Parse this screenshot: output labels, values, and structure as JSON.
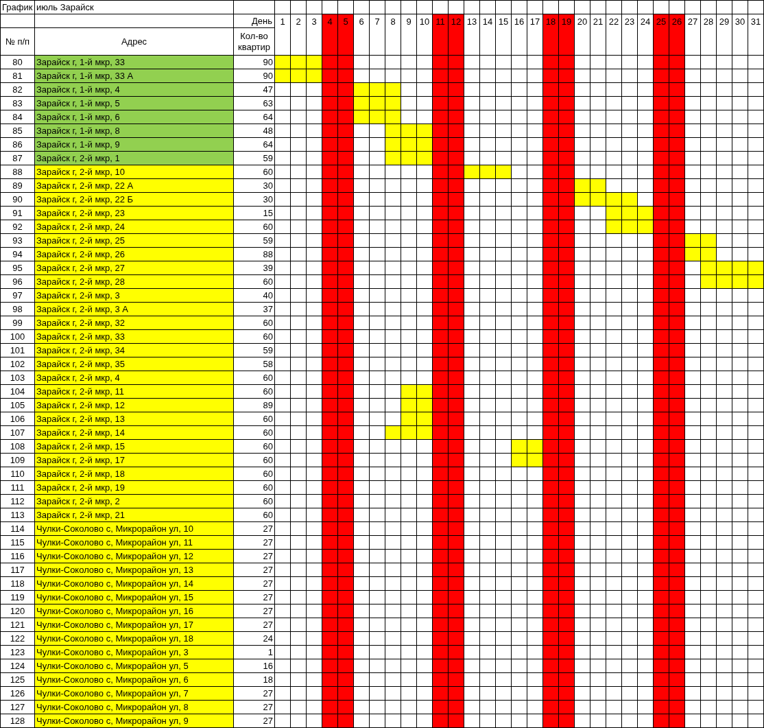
{
  "sheet": {
    "label": "График",
    "title": "июль Зарайск"
  },
  "headers": {
    "day": "День",
    "number": "№ п/п",
    "address": "Адрес",
    "quantity": "Кол-во квартир"
  },
  "days": [
    {
      "label": "1",
      "weekend": false
    },
    {
      "label": "2",
      "weekend": false
    },
    {
      "label": "3",
      "weekend": false
    },
    {
      "label": "4",
      "weekend": true
    },
    {
      "label": "5",
      "weekend": true
    },
    {
      "label": "6",
      "weekend": false
    },
    {
      "label": "7",
      "weekend": false
    },
    {
      "label": "8",
      "weekend": false
    },
    {
      "label": "9",
      "weekend": false
    },
    {
      "label": "10",
      "weekend": false
    },
    {
      "label": "11",
      "weekend": true
    },
    {
      "label": "12",
      "weekend": true
    },
    {
      "label": "13",
      "weekend": false
    },
    {
      "label": "14",
      "weekend": false
    },
    {
      "label": "15",
      "weekend": false
    },
    {
      "label": "16",
      "weekend": false
    },
    {
      "label": "17",
      "weekend": false
    },
    {
      "label": "18",
      "weekend": true
    },
    {
      "label": "19",
      "weekend": true
    },
    {
      "label": "20",
      "weekend": false
    },
    {
      "label": "21",
      "weekend": false
    },
    {
      "label": "22",
      "weekend": false
    },
    {
      "label": "23",
      "weekend": false
    },
    {
      "label": "24",
      "weekend": false
    },
    {
      "label": "25",
      "weekend": true
    },
    {
      "label": "26",
      "weekend": true
    },
    {
      "label": "27",
      "weekend": false
    },
    {
      "label": "28",
      "weekend": false
    },
    {
      "label": "29",
      "weekend": false
    },
    {
      "label": "30",
      "weekend": false
    },
    {
      "label": "31",
      "weekend": false
    }
  ],
  "rows": [
    {
      "number": "80",
      "address": "Зарайск г, 1-й мкр, 33",
      "color": "#92d050",
      "quantity": "90",
      "filled": [
        true,
        true,
        true,
        false,
        false,
        false,
        false,
        false,
        false,
        false,
        false,
        false,
        false,
        false,
        false,
        false,
        false,
        false,
        false,
        false,
        false,
        false,
        false,
        false,
        false,
        false,
        false,
        false,
        false,
        false,
        false
      ]
    },
    {
      "number": "81",
      "address": "Зарайск г, 1-й мкр, 33 А",
      "color": "#92d050",
      "quantity": "90",
      "filled": [
        true,
        true,
        true,
        false,
        false,
        false,
        false,
        false,
        false,
        false,
        false,
        false,
        false,
        false,
        false,
        false,
        false,
        false,
        false,
        false,
        false,
        false,
        false,
        false,
        false,
        false,
        false,
        false,
        false,
        false,
        false
      ]
    },
    {
      "number": "82",
      "address": "Зарайск г, 1-й мкр, 4",
      "color": "#92d050",
      "quantity": "47",
      "filled": [
        false,
        false,
        false,
        false,
        false,
        true,
        true,
        true,
        false,
        false,
        false,
        false,
        false,
        false,
        false,
        false,
        false,
        false,
        false,
        false,
        false,
        false,
        false,
        false,
        false,
        false,
        false,
        false,
        false,
        false,
        false
      ]
    },
    {
      "number": "83",
      "address": "Зарайск г, 1-й мкр, 5",
      "color": "#92d050",
      "quantity": "63",
      "filled": [
        false,
        false,
        false,
        false,
        false,
        true,
        true,
        true,
        false,
        false,
        false,
        false,
        false,
        false,
        false,
        false,
        false,
        false,
        false,
        false,
        false,
        false,
        false,
        false,
        false,
        false,
        false,
        false,
        false,
        false,
        false
      ]
    },
    {
      "number": "84",
      "address": "Зарайск г, 1-й мкр, 6",
      "color": "#92d050",
      "quantity": "64",
      "filled": [
        false,
        false,
        false,
        false,
        false,
        true,
        true,
        true,
        false,
        false,
        false,
        false,
        false,
        false,
        false,
        false,
        false,
        false,
        false,
        false,
        false,
        false,
        false,
        false,
        false,
        false,
        false,
        false,
        false,
        false,
        false
      ]
    },
    {
      "number": "85",
      "address": "Зарайск г, 1-й мкр, 8",
      "color": "#92d050",
      "quantity": "48",
      "filled": [
        false,
        false,
        false,
        false,
        false,
        false,
        false,
        true,
        true,
        true,
        false,
        false,
        false,
        false,
        false,
        false,
        false,
        false,
        false,
        false,
        false,
        false,
        false,
        false,
        false,
        false,
        false,
        false,
        false,
        false,
        false
      ]
    },
    {
      "number": "86",
      "address": "Зарайск г, 1-й мкр, 9",
      "color": "#92d050",
      "quantity": "64",
      "filled": [
        false,
        false,
        false,
        false,
        false,
        false,
        false,
        true,
        true,
        true,
        false,
        false,
        false,
        false,
        false,
        false,
        false,
        false,
        false,
        false,
        false,
        false,
        false,
        false,
        false,
        false,
        false,
        false,
        false,
        false,
        false
      ]
    },
    {
      "number": "87",
      "address": "Зарайск г, 2-й мкр, 1",
      "color": "#92d050",
      "quantity": "59",
      "filled": [
        false,
        false,
        false,
        false,
        false,
        false,
        false,
        true,
        true,
        true,
        false,
        false,
        false,
        false,
        false,
        false,
        false,
        false,
        false,
        false,
        false,
        false,
        false,
        false,
        false,
        false,
        false,
        false,
        false,
        false,
        false
      ]
    },
    {
      "number": "88",
      "address": "Зарайск г, 2-й мкр, 10",
      "color": "#ffff00",
      "quantity": "60",
      "filled": [
        false,
        false,
        false,
        false,
        false,
        false,
        false,
        false,
        false,
        false,
        false,
        false,
        true,
        true,
        true,
        false,
        false,
        false,
        false,
        false,
        false,
        false,
        false,
        false,
        false,
        false,
        false,
        false,
        false,
        false,
        false
      ]
    },
    {
      "number": "89",
      "address": "Зарайск г, 2-й мкр, 22 А",
      "color": "#ffff00",
      "quantity": "30",
      "filled": [
        false,
        false,
        false,
        false,
        false,
        false,
        false,
        false,
        false,
        false,
        false,
        false,
        false,
        false,
        false,
        false,
        false,
        false,
        false,
        true,
        true,
        false,
        false,
        false,
        false,
        false,
        false,
        false,
        false,
        false,
        false
      ]
    },
    {
      "number": "90",
      "address": "Зарайск г, 2-й мкр, 22 Б",
      "color": "#ffff00",
      "quantity": "30",
      "filled": [
        false,
        false,
        false,
        false,
        false,
        false,
        false,
        false,
        false,
        false,
        false,
        false,
        false,
        false,
        false,
        false,
        false,
        false,
        false,
        true,
        true,
        true,
        true,
        false,
        false,
        false,
        false,
        false,
        false,
        false,
        false
      ]
    },
    {
      "number": "91",
      "address": "Зарайск г, 2-й мкр, 23",
      "color": "#ffff00",
      "quantity": "15",
      "filled": [
        false,
        false,
        false,
        false,
        false,
        false,
        false,
        false,
        false,
        false,
        false,
        false,
        false,
        false,
        false,
        false,
        false,
        false,
        false,
        false,
        false,
        true,
        true,
        true,
        false,
        false,
        false,
        false,
        false,
        false,
        false
      ]
    },
    {
      "number": "92",
      "address": "Зарайск г, 2-й мкр, 24",
      "color": "#ffff00",
      "quantity": "60",
      "filled": [
        false,
        false,
        false,
        false,
        false,
        false,
        false,
        false,
        false,
        false,
        false,
        false,
        false,
        false,
        false,
        false,
        false,
        false,
        false,
        false,
        false,
        true,
        true,
        true,
        false,
        false,
        false,
        false,
        false,
        false,
        false
      ]
    },
    {
      "number": "93",
      "address": "Зарайск г, 2-й мкр, 25",
      "color": "#ffff00",
      "quantity": "59",
      "filled": [
        false,
        false,
        false,
        false,
        false,
        false,
        false,
        false,
        false,
        false,
        false,
        false,
        false,
        false,
        false,
        false,
        false,
        false,
        false,
        false,
        false,
        false,
        false,
        false,
        false,
        false,
        true,
        true,
        false,
        false,
        false
      ]
    },
    {
      "number": "94",
      "address": "Зарайск г, 2-й мкр, 26",
      "color": "#ffff00",
      "quantity": "88",
      "filled": [
        false,
        false,
        false,
        false,
        false,
        false,
        false,
        false,
        false,
        false,
        false,
        false,
        false,
        false,
        false,
        false,
        false,
        false,
        false,
        false,
        false,
        false,
        false,
        false,
        false,
        false,
        true,
        true,
        false,
        false,
        false
      ]
    },
    {
      "number": "95",
      "address": "Зарайск г, 2-й мкр, 27",
      "color": "#ffff00",
      "quantity": "39",
      "filled": [
        false,
        false,
        false,
        false,
        false,
        false,
        false,
        false,
        false,
        false,
        false,
        false,
        false,
        false,
        false,
        false,
        false,
        false,
        false,
        false,
        false,
        false,
        false,
        false,
        false,
        false,
        false,
        true,
        true,
        true,
        true
      ]
    },
    {
      "number": "96",
      "address": "Зарайск г, 2-й мкр, 28",
      "color": "#ffff00",
      "quantity": "60",
      "filled": [
        false,
        false,
        false,
        false,
        false,
        false,
        false,
        false,
        false,
        false,
        false,
        false,
        false,
        false,
        false,
        false,
        false,
        false,
        false,
        false,
        false,
        false,
        false,
        false,
        false,
        false,
        false,
        true,
        true,
        true,
        true
      ]
    },
    {
      "number": "97",
      "address": "Зарайск г, 2-й мкр, 3",
      "color": "#ffff00",
      "quantity": "40",
      "filled": [
        false,
        false,
        false,
        false,
        false,
        false,
        false,
        false,
        false,
        false,
        false,
        false,
        false,
        false,
        false,
        false,
        false,
        false,
        false,
        false,
        false,
        false,
        false,
        false,
        false,
        false,
        false,
        false,
        false,
        false,
        false
      ]
    },
    {
      "number": "98",
      "address": "Зарайск г, 2-й мкр, 3 А",
      "color": "#ffff00",
      "quantity": "37",
      "filled": [
        false,
        false,
        false,
        false,
        false,
        false,
        false,
        false,
        false,
        false,
        false,
        false,
        false,
        false,
        false,
        false,
        false,
        false,
        false,
        false,
        false,
        false,
        false,
        false,
        false,
        false,
        false,
        false,
        false,
        false,
        false
      ]
    },
    {
      "number": "99",
      "address": "Зарайск г, 2-й мкр, 32",
      "color": "#ffff00",
      "quantity": "60",
      "filled": [
        false,
        false,
        false,
        false,
        false,
        false,
        false,
        false,
        false,
        false,
        false,
        false,
        false,
        false,
        false,
        false,
        false,
        false,
        false,
        false,
        false,
        false,
        false,
        false,
        false,
        false,
        false,
        false,
        false,
        false,
        false
      ]
    },
    {
      "number": "100",
      "address": "Зарайск г, 2-й мкр, 33",
      "color": "#ffff00",
      "quantity": "60",
      "filled": [
        false,
        false,
        false,
        false,
        false,
        false,
        false,
        false,
        false,
        false,
        false,
        false,
        false,
        false,
        false,
        false,
        false,
        false,
        false,
        false,
        false,
        false,
        false,
        false,
        false,
        false,
        false,
        false,
        false,
        false,
        false
      ]
    },
    {
      "number": "101",
      "address": "Зарайск г, 2-й мкр, 34",
      "color": "#ffff00",
      "quantity": "59",
      "filled": [
        false,
        false,
        false,
        false,
        false,
        false,
        false,
        false,
        false,
        false,
        false,
        false,
        false,
        false,
        false,
        false,
        false,
        false,
        false,
        false,
        false,
        false,
        false,
        false,
        false,
        false,
        false,
        false,
        false,
        false,
        false
      ]
    },
    {
      "number": "102",
      "address": "Зарайск г, 2-й мкр, 35",
      "color": "#ffff00",
      "quantity": "58",
      "filled": [
        false,
        false,
        false,
        false,
        false,
        false,
        false,
        false,
        false,
        false,
        false,
        false,
        false,
        false,
        false,
        false,
        false,
        false,
        false,
        false,
        false,
        false,
        false,
        false,
        false,
        false,
        false,
        false,
        false,
        false,
        false
      ]
    },
    {
      "number": "103",
      "address": "Зарайск г, 2-й мкр, 4",
      "color": "#ffff00",
      "quantity": "60",
      "filled": [
        false,
        false,
        false,
        false,
        false,
        false,
        false,
        false,
        false,
        false,
        false,
        false,
        false,
        false,
        false,
        false,
        false,
        false,
        false,
        false,
        false,
        false,
        false,
        false,
        false,
        false,
        false,
        false,
        false,
        false,
        false
      ]
    },
    {
      "number": "104",
      "address": "Зарайск г, 2-й мкр, 11",
      "color": "#ffff00",
      "quantity": "60",
      "filled": [
        false,
        false,
        false,
        false,
        false,
        false,
        false,
        false,
        true,
        true,
        false,
        false,
        false,
        false,
        false,
        false,
        false,
        false,
        false,
        false,
        false,
        false,
        false,
        false,
        false,
        false,
        false,
        false,
        false,
        false,
        false
      ]
    },
    {
      "number": "105",
      "address": "Зарайск г, 2-й мкр, 12",
      "color": "#ffff00",
      "quantity": "89",
      "filled": [
        false,
        false,
        false,
        false,
        false,
        false,
        false,
        false,
        true,
        true,
        false,
        false,
        false,
        false,
        false,
        false,
        false,
        false,
        false,
        false,
        false,
        false,
        false,
        false,
        false,
        false,
        false,
        false,
        false,
        false,
        false
      ]
    },
    {
      "number": "106",
      "address": "Зарайск г, 2-й мкр, 13",
      "color": "#ffff00",
      "quantity": "60",
      "filled": [
        false,
        false,
        false,
        false,
        false,
        false,
        false,
        false,
        true,
        true,
        false,
        false,
        false,
        false,
        false,
        false,
        false,
        false,
        false,
        false,
        false,
        false,
        false,
        false,
        false,
        false,
        false,
        false,
        false,
        false,
        false
      ]
    },
    {
      "number": "107",
      "address": "Зарайск г, 2-й мкр, 14",
      "color": "#ffff00",
      "quantity": "60",
      "filled": [
        false,
        false,
        false,
        false,
        false,
        false,
        false,
        true,
        true,
        true,
        false,
        false,
        false,
        false,
        false,
        false,
        false,
        false,
        false,
        false,
        false,
        false,
        false,
        false,
        false,
        false,
        false,
        false,
        false,
        false,
        false
      ]
    },
    {
      "number": "108",
      "address": "Зарайск г, 2-й мкр, 15",
      "color": "#ffff00",
      "quantity": "60",
      "filled": [
        false,
        false,
        false,
        false,
        false,
        false,
        false,
        false,
        false,
        false,
        false,
        false,
        false,
        false,
        false,
        true,
        true,
        false,
        false,
        false,
        false,
        false,
        false,
        false,
        false,
        false,
        false,
        false,
        false,
        false,
        false
      ]
    },
    {
      "number": "109",
      "address": "Зарайск г, 2-й мкр, 17",
      "color": "#ffff00",
      "quantity": "60",
      "filled": [
        false,
        false,
        false,
        false,
        false,
        false,
        false,
        false,
        false,
        false,
        false,
        false,
        false,
        false,
        false,
        true,
        true,
        false,
        false,
        false,
        false,
        false,
        false,
        false,
        false,
        false,
        false,
        false,
        false,
        false,
        false
      ]
    },
    {
      "number": "110",
      "address": "Зарайск г, 2-й мкр, 18",
      "color": "#ffff00",
      "quantity": "60",
      "filled": [
        false,
        false,
        false,
        false,
        false,
        false,
        false,
        false,
        false,
        false,
        false,
        false,
        false,
        false,
        false,
        false,
        false,
        false,
        false,
        false,
        false,
        false,
        false,
        false,
        false,
        false,
        false,
        false,
        false,
        false,
        false
      ]
    },
    {
      "number": "111",
      "address": "Зарайск г, 2-й мкр, 19",
      "color": "#ffff00",
      "quantity": "60",
      "filled": [
        false,
        false,
        false,
        false,
        false,
        false,
        false,
        false,
        false,
        false,
        false,
        false,
        false,
        false,
        false,
        false,
        false,
        false,
        false,
        false,
        false,
        false,
        false,
        false,
        false,
        false,
        false,
        false,
        false,
        false,
        false
      ]
    },
    {
      "number": "112",
      "address": "Зарайск г, 2-й мкр, 2",
      "color": "#ffff00",
      "quantity": "60",
      "filled": [
        false,
        false,
        false,
        false,
        false,
        false,
        false,
        false,
        false,
        false,
        false,
        false,
        false,
        false,
        false,
        false,
        false,
        false,
        false,
        false,
        false,
        false,
        false,
        false,
        false,
        false,
        false,
        false,
        false,
        false,
        false
      ]
    },
    {
      "number": "113",
      "address": "Зарайск г, 2-й мкр, 21",
      "color": "#ffff00",
      "quantity": "60",
      "filled": [
        false,
        false,
        false,
        false,
        false,
        false,
        false,
        false,
        false,
        false,
        false,
        false,
        false,
        false,
        false,
        false,
        false,
        false,
        false,
        false,
        false,
        false,
        false,
        false,
        false,
        false,
        false,
        false,
        false,
        false,
        false
      ]
    },
    {
      "number": "114",
      "address": "Чулки-Соколово с, Микрорайон ул, 10",
      "color": "#ffff00",
      "quantity": "27",
      "filled": [
        false,
        false,
        false,
        false,
        false,
        false,
        false,
        false,
        false,
        false,
        false,
        false,
        false,
        false,
        false,
        false,
        false,
        false,
        false,
        false,
        false,
        false,
        false,
        false,
        false,
        false,
        false,
        false,
        false,
        false,
        false
      ]
    },
    {
      "number": "115",
      "address": "Чулки-Соколово с, Микрорайон ул, 11",
      "color": "#ffff00",
      "quantity": "27",
      "filled": [
        false,
        false,
        false,
        false,
        false,
        false,
        false,
        false,
        false,
        false,
        false,
        false,
        false,
        false,
        false,
        false,
        false,
        false,
        false,
        false,
        false,
        false,
        false,
        false,
        false,
        false,
        false,
        false,
        false,
        false,
        false
      ]
    },
    {
      "number": "116",
      "address": "Чулки-Соколово с, Микрорайон ул, 12",
      "color": "#ffff00",
      "quantity": "27",
      "filled": [
        false,
        false,
        false,
        false,
        false,
        false,
        false,
        false,
        false,
        false,
        false,
        false,
        false,
        false,
        false,
        false,
        false,
        false,
        false,
        false,
        false,
        false,
        false,
        false,
        false,
        false,
        false,
        false,
        false,
        false,
        false
      ]
    },
    {
      "number": "117",
      "address": "Чулки-Соколово с, Микрорайон ул, 13",
      "color": "#ffff00",
      "quantity": "27",
      "filled": [
        false,
        false,
        false,
        false,
        false,
        false,
        false,
        false,
        false,
        false,
        false,
        false,
        false,
        false,
        false,
        false,
        false,
        false,
        false,
        false,
        false,
        false,
        false,
        false,
        false,
        false,
        false,
        false,
        false,
        false,
        false
      ]
    },
    {
      "number": "118",
      "address": "Чулки-Соколово с, Микрорайон ул, 14",
      "color": "#ffff00",
      "quantity": "27",
      "filled": [
        false,
        false,
        false,
        false,
        false,
        false,
        false,
        false,
        false,
        false,
        false,
        false,
        false,
        false,
        false,
        false,
        false,
        false,
        false,
        false,
        false,
        false,
        false,
        false,
        false,
        false,
        false,
        false,
        false,
        false,
        false
      ]
    },
    {
      "number": "119",
      "address": "Чулки-Соколово с, Микрорайон ул, 15",
      "color": "#ffff00",
      "quantity": "27",
      "filled": [
        false,
        false,
        false,
        false,
        false,
        false,
        false,
        false,
        false,
        false,
        false,
        false,
        false,
        false,
        false,
        false,
        false,
        false,
        false,
        false,
        false,
        false,
        false,
        false,
        false,
        false,
        false,
        false,
        false,
        false,
        false
      ]
    },
    {
      "number": "120",
      "address": "Чулки-Соколово с, Микрорайон ул, 16",
      "color": "#ffff00",
      "quantity": "27",
      "filled": [
        false,
        false,
        false,
        false,
        false,
        false,
        false,
        false,
        false,
        false,
        false,
        false,
        false,
        false,
        false,
        false,
        false,
        false,
        false,
        false,
        false,
        false,
        false,
        false,
        false,
        false,
        false,
        false,
        false,
        false,
        false
      ]
    },
    {
      "number": "121",
      "address": "Чулки-Соколово с, Микрорайон ул, 17",
      "color": "#ffff00",
      "quantity": "27",
      "filled": [
        false,
        false,
        false,
        false,
        false,
        false,
        false,
        false,
        false,
        false,
        false,
        false,
        false,
        false,
        false,
        false,
        false,
        false,
        false,
        false,
        false,
        false,
        false,
        false,
        false,
        false,
        false,
        false,
        false,
        false,
        false
      ]
    },
    {
      "number": "122",
      "address": "Чулки-Соколово с, Микрорайон ул, 18",
      "color": "#ffff00",
      "quantity": "24",
      "filled": [
        false,
        false,
        false,
        false,
        false,
        false,
        false,
        false,
        false,
        false,
        false,
        false,
        false,
        false,
        false,
        false,
        false,
        false,
        false,
        false,
        false,
        false,
        false,
        false,
        false,
        false,
        false,
        false,
        false,
        false,
        false
      ]
    },
    {
      "number": "123",
      "address": "Чулки-Соколово с, Микрорайон ул, 3",
      "color": "#ffff00",
      "quantity": "1",
      "filled": [
        false,
        false,
        false,
        false,
        false,
        false,
        false,
        false,
        false,
        false,
        false,
        false,
        false,
        false,
        false,
        false,
        false,
        false,
        false,
        false,
        false,
        false,
        false,
        false,
        false,
        false,
        false,
        false,
        false,
        false,
        false
      ]
    },
    {
      "number": "124",
      "address": "Чулки-Соколово с, Микрорайон ул, 5",
      "color": "#ffff00",
      "quantity": "16",
      "filled": [
        false,
        false,
        false,
        false,
        false,
        false,
        false,
        false,
        false,
        false,
        false,
        false,
        false,
        false,
        false,
        false,
        false,
        false,
        false,
        false,
        false,
        false,
        false,
        false,
        false,
        false,
        false,
        false,
        false,
        false,
        false
      ]
    },
    {
      "number": "125",
      "address": "Чулки-Соколово с, Микрорайон ул, 6",
      "color": "#ffff00",
      "quantity": "18",
      "filled": [
        false,
        false,
        false,
        false,
        false,
        false,
        false,
        false,
        false,
        false,
        false,
        false,
        false,
        false,
        false,
        false,
        false,
        false,
        false,
        false,
        false,
        false,
        false,
        false,
        false,
        false,
        false,
        false,
        false,
        false,
        false
      ]
    },
    {
      "number": "126",
      "address": "Чулки-Соколово с, Микрорайон ул, 7",
      "color": "#ffff00",
      "quantity": "27",
      "filled": [
        false,
        false,
        false,
        false,
        false,
        false,
        false,
        false,
        false,
        false,
        false,
        false,
        false,
        false,
        false,
        false,
        false,
        false,
        false,
        false,
        false,
        false,
        false,
        false,
        false,
        false,
        false,
        false,
        false,
        false,
        false
      ]
    },
    {
      "number": "127",
      "address": "Чулки-Соколово с, Микрорайон ул, 8",
      "color": "#ffff00",
      "quantity": "27",
      "filled": [
        false,
        false,
        false,
        false,
        false,
        false,
        false,
        false,
        false,
        false,
        false,
        false,
        false,
        false,
        false,
        false,
        false,
        false,
        false,
        false,
        false,
        false,
        false,
        false,
        false,
        false,
        false,
        false,
        false,
        false,
        false
      ]
    },
    {
      "number": "128",
      "address": "Чулки-Соколово с, Микрорайон ул, 9",
      "color": "#ffff00",
      "quantity": "27",
      "filled": [
        false,
        false,
        false,
        false,
        false,
        false,
        false,
        false,
        false,
        false,
        false,
        false,
        false,
        false,
        false,
        false,
        false,
        false,
        false,
        false,
        false,
        false,
        false,
        false,
        false,
        false,
        false,
        false,
        false,
        false,
        false
      ]
    }
  ]
}
